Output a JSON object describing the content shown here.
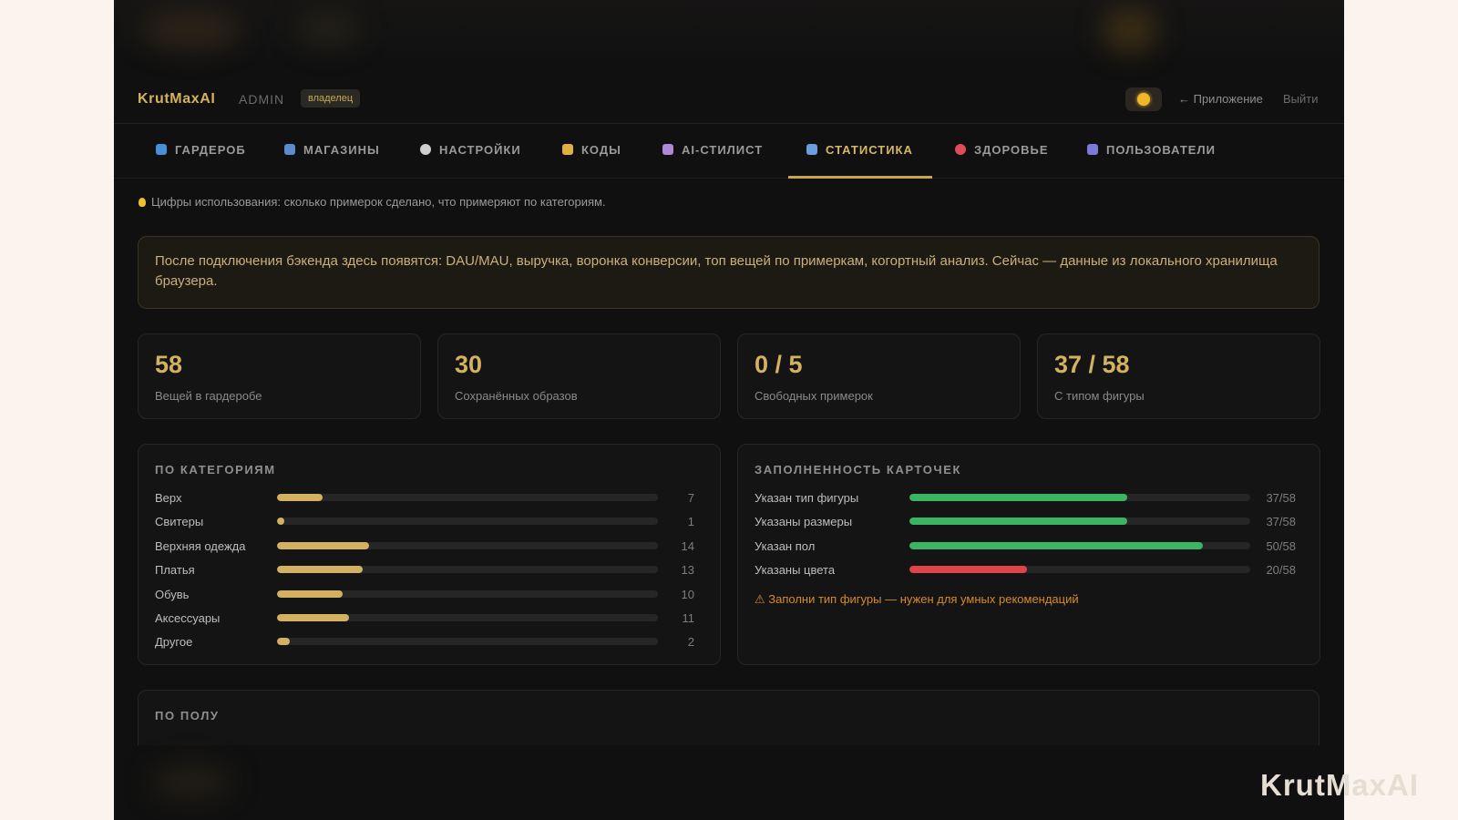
{
  "header": {
    "brand": "KrutMaxAI",
    "admin": "ADMIN",
    "role_badge": "владелец",
    "to_app": "← Приложение",
    "logout": "Выйти"
  },
  "tabs": [
    {
      "label": "ГАРДЕРОБ",
      "icon": "tshirt-icon",
      "color": "#4a8fd6"
    },
    {
      "label": "МАГАЗИНЫ",
      "icon": "store-icon",
      "color": "#5b8ccc"
    },
    {
      "label": "НАСТРОЙКИ",
      "icon": "gear-icon",
      "color": "#cfcfcf"
    },
    {
      "label": "КОДЫ",
      "icon": "key-icon",
      "color": "#e0b040"
    },
    {
      "label": "AI-СТИЛИСТ",
      "icon": "robot-icon",
      "color": "#b088d8"
    },
    {
      "label": "СТАТИСТИКА",
      "icon": "chart-icon",
      "color": "#6a9ee0"
    },
    {
      "label": "ЗДОРОВЬЕ",
      "icon": "heart-icon",
      "color": "#e04a5a"
    },
    {
      "label": "ПОЛЬЗОВАТЕЛИ",
      "icon": "users-icon",
      "color": "#7a7ad8"
    }
  ],
  "active_tab": "СТАТИСТИКА",
  "hint": "Цифры использования: сколько примерок сделано, что примеряют по категориям.",
  "notice": "После подключения бэкенда здесь появятся: DAU/MAU, выручка, воронка конверсии, топ вещей по примеркам, когортный анализ. Сейчас — данные из локального хранилища браузера.",
  "stats": [
    {
      "value": "58",
      "label": "Вещей в гардеробе"
    },
    {
      "value": "30",
      "label": "Сохранённых образов"
    },
    {
      "value": "0 / 5",
      "label": "Свободных примерок"
    },
    {
      "value": "37 / 58",
      "label": "С типом фигуры"
    }
  ],
  "categories_panel": {
    "title": "ПО КАТЕГОРИЯМ",
    "max": 58,
    "bar_color": "#d4b160",
    "rows": [
      {
        "label": "Верх",
        "value": 7
      },
      {
        "label": "Свитеры",
        "value": 1
      },
      {
        "label": "Верхняя одежда",
        "value": 14
      },
      {
        "label": "Платья",
        "value": 13
      },
      {
        "label": "Обувь",
        "value": 10
      },
      {
        "label": "Аксессуары",
        "value": 11
      },
      {
        "label": "Другое",
        "value": 2
      }
    ]
  },
  "completeness_panel": {
    "title": "ЗАПОЛНЕННОСТЬ КАРТОЧЕК",
    "rows": [
      {
        "label": "Указан тип фигуры",
        "value": "37/58",
        "fraction": 0.638,
        "color": "#3cb563"
      },
      {
        "label": "Указаны размеры",
        "value": "37/58",
        "fraction": 0.638,
        "color": "#3cb563"
      },
      {
        "label": "Указан пол",
        "value": "50/58",
        "fraction": 0.862,
        "color": "#3cb563"
      },
      {
        "label": "Указаны цвета",
        "value": "20/58",
        "fraction": 0.345,
        "color": "#e0444a"
      }
    ],
    "warning": "⚠ Заполни тип фигуры — нужен для умных рекомендаций"
  },
  "gender_panel": {
    "title": "ПО ПОЛУ"
  },
  "watermark": "KrutMaxAI"
}
